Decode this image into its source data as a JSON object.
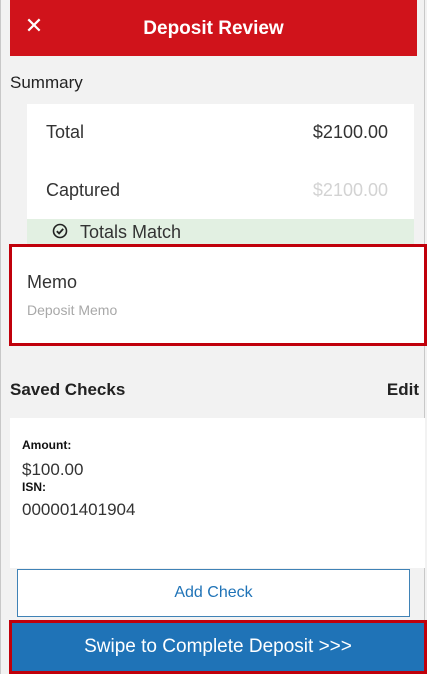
{
  "header": {
    "title": "Deposit Review",
    "close_icon": "close-icon"
  },
  "summary": {
    "label": "Summary",
    "total_label": "Total",
    "total_value": "$2100.00",
    "captured_label": "Captured",
    "captured_value": "$2100.00",
    "match_text": "Totals Match"
  },
  "memo": {
    "label": "Memo",
    "placeholder": "Deposit Memo"
  },
  "saved_checks": {
    "title": "Saved Checks",
    "edit_label": "Edit",
    "items": [
      {
        "amount_label": "Amount:",
        "amount": "$100.00",
        "isn_label": "ISN:",
        "isn": "000001401904"
      }
    ]
  },
  "actions": {
    "add_check": "Add Check",
    "swipe_complete": "Swipe to Complete Deposit >>>"
  },
  "colors": {
    "brand_red": "#d0131b",
    "action_blue": "#1f73b7",
    "match_green": "#e2f0e2"
  }
}
